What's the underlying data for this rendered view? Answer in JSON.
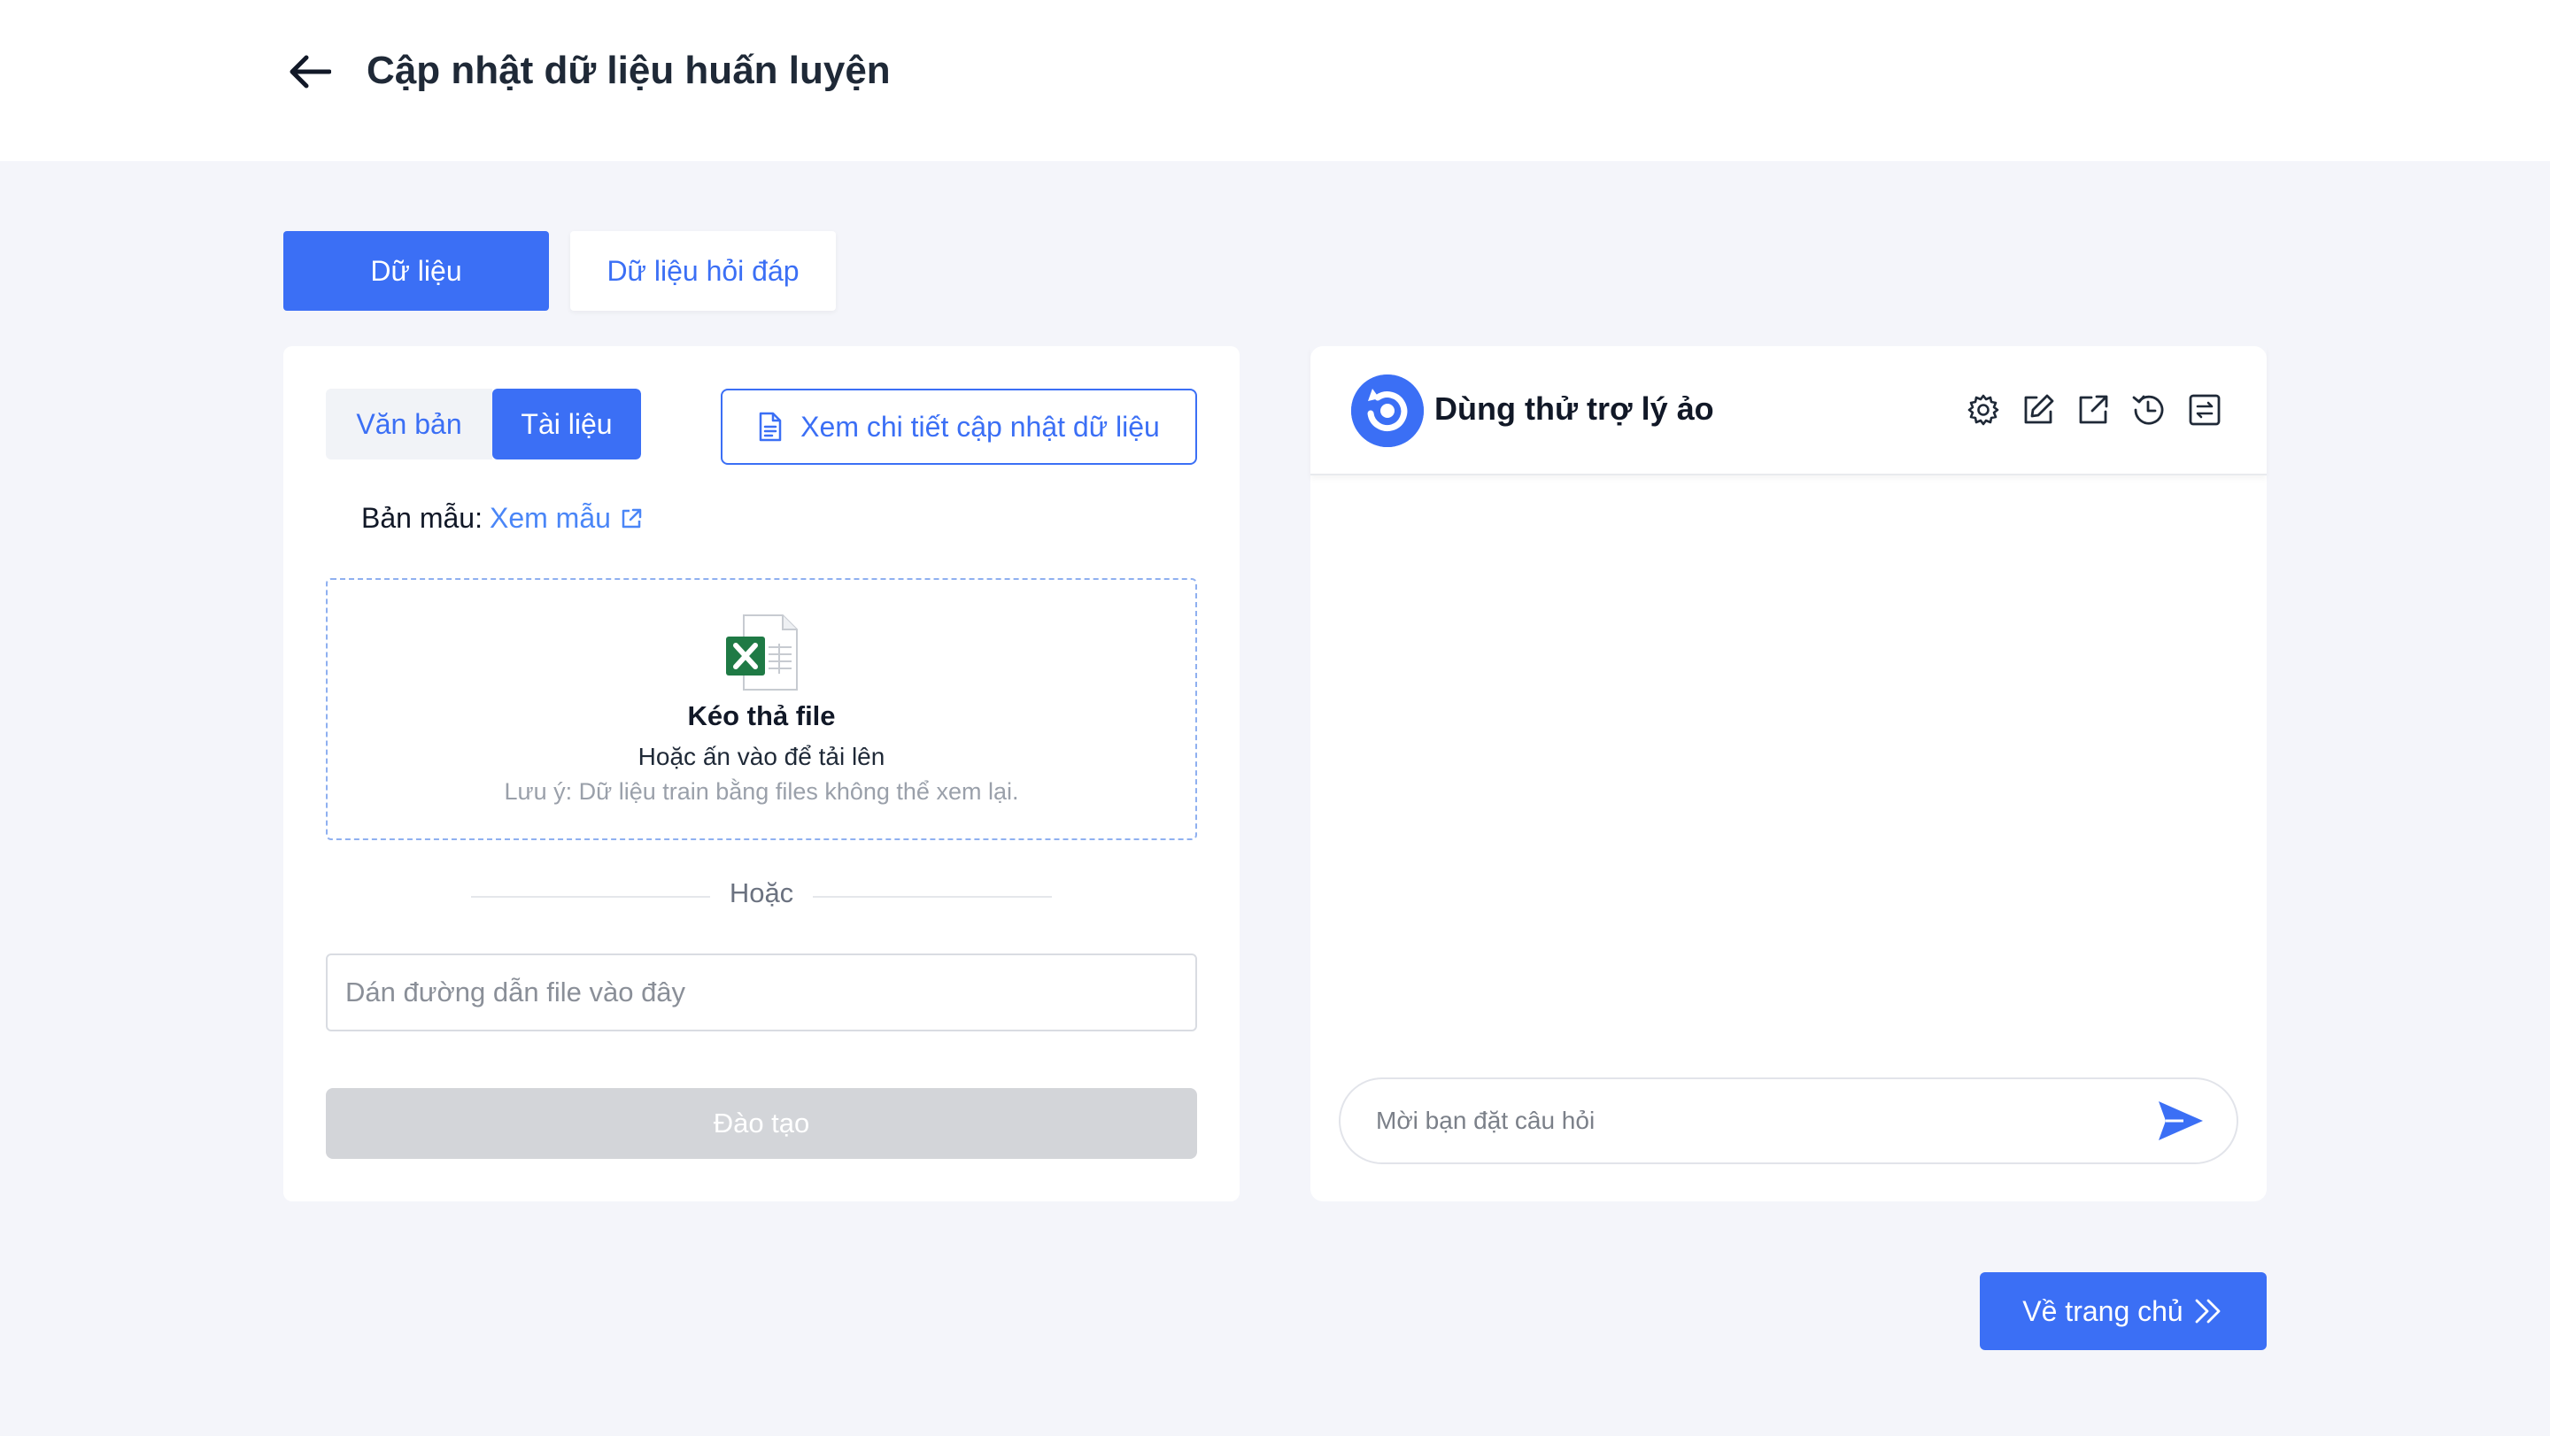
{
  "header": {
    "back_icon": "arrow-left-icon",
    "title": "Cập nhật dữ liệu huấn luyện"
  },
  "tabs": [
    {
      "label": "Dữ liệu",
      "active": true
    },
    {
      "label": "Dữ liệu hỏi đáp",
      "active": false
    }
  ],
  "left_panel": {
    "segments": [
      {
        "label": "Văn bản",
        "active": false
      },
      {
        "label": "Tài liệu",
        "active": true
      }
    ],
    "detail_button": {
      "label": "Xem chi tiết cập nhật dữ liệu",
      "icon": "document-icon"
    },
    "template": {
      "label": "Bản mẫu:",
      "link": "Xem mẫu",
      "icon": "external-link-icon"
    },
    "dropzone": {
      "icon": "excel-file-icon",
      "title": "Kéo thả file",
      "subtitle": "Hoặc ấn vào để tải lên",
      "note": "Lưu ý: Dữ liệu train bằng files không thể xem lại."
    },
    "divider": "Hoặc",
    "url_input": {
      "value": "",
      "placeholder": "Dán đường dẫn file vào đây"
    },
    "train_button": "Đào tạo"
  },
  "chat_panel": {
    "title": "Dùng thử trợ lý ảo",
    "header_icons": [
      "settings-icon",
      "edit-icon",
      "open-external-icon",
      "history-icon",
      "reset-icon"
    ],
    "input": {
      "value": "",
      "placeholder": "Mời bạn đặt câu hỏi"
    },
    "send_icon": "send-icon"
  },
  "footer": {
    "home_button": "Về trang chủ",
    "home_icon": "double-chevron-right-icon"
  },
  "colors": {
    "primary": "#3b6ff5",
    "background": "#f4f5fa",
    "disabled": "#d3d5d9",
    "excel_green": "#1f7a45"
  }
}
